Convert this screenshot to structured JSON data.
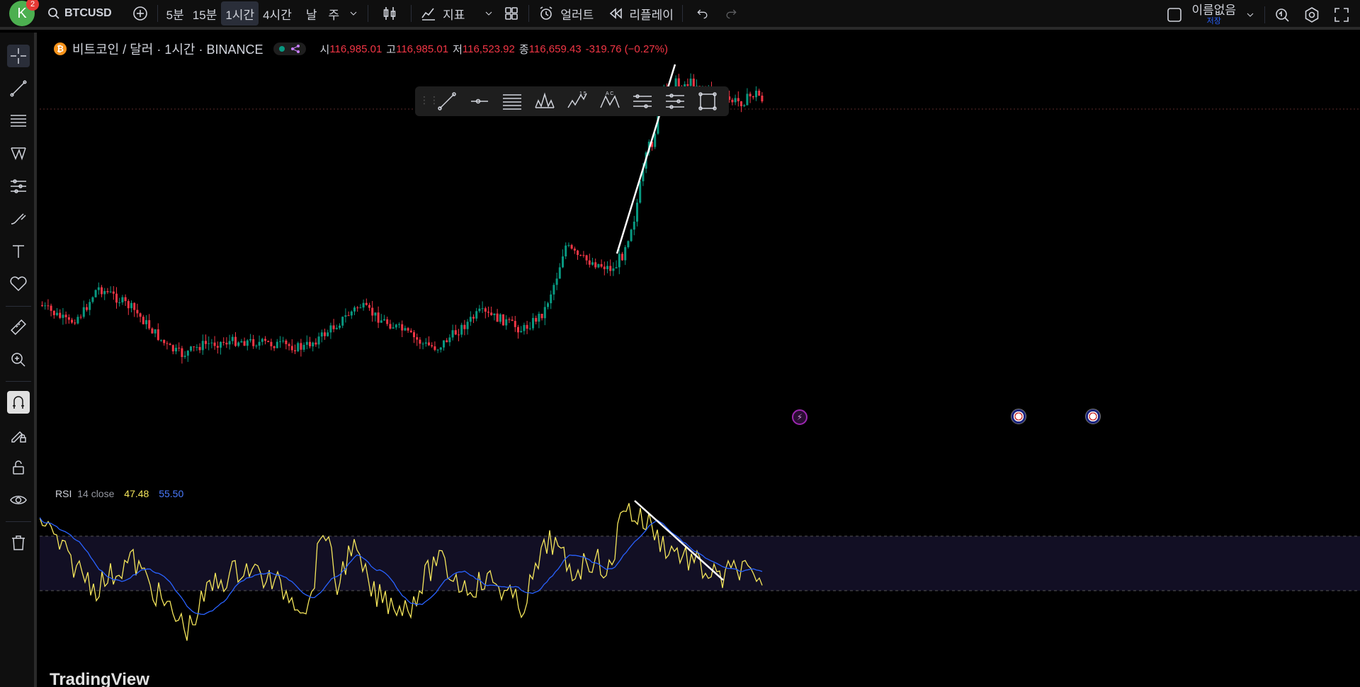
{
  "topbar": {
    "avatar_letter": "K",
    "notification_count": "2",
    "symbol": "BTCUSD",
    "intervals": [
      "5분",
      "15분",
      "1시간",
      "4시간",
      "날",
      "주"
    ],
    "active_interval": "1시간",
    "indicators_label": "지표",
    "alerts_label": "얼러트",
    "replay_label": "리플레이",
    "layout_name": "이름없음",
    "layout_save_label": "저장"
  },
  "legend": {
    "coin_glyph": "₿",
    "title": "비트코인 / 달러 · 1시간 · BINANCE",
    "open_label": "시",
    "open": "116,985.01",
    "high_label": "고",
    "high": "116,985.01",
    "low_label": "저",
    "low": "116,523.92",
    "close_label": "종",
    "close": "116,659.43",
    "change": "-319.76 (−0.27%)"
  },
  "rsi": {
    "name": "RSI",
    "params": "14 close",
    "value": "47.48",
    "ma_value": "55.50"
  },
  "watermark": "TradingView",
  "colors": {
    "up": "#089981",
    "down": "#f23645",
    "rsi_line": "#f5e65b",
    "rsi_ma": "#2962ff",
    "trendline": "#ffffff"
  },
  "icons": {
    "left_toolbar": [
      "crosshair-icon",
      "trendline-icon",
      "fib-icon",
      "pattern-icon",
      "forecast-icon",
      "brush-icon",
      "text-icon",
      "heart-icon",
      "ruler-icon",
      "zoom-in-icon",
      "magnet-icon",
      "lock-pencil-icon",
      "lock-icon",
      "eye-icon",
      "trash-icon"
    ]
  },
  "chart_data": {
    "type": "candlestick",
    "symbol": "BTCUSD",
    "interval": "1시간",
    "exchange": "BINANCE",
    "last_bar": {
      "open": 116985.01,
      "high": 116985.01,
      "low": 116523.92,
      "close": 116659.43,
      "change": -319.76,
      "change_pct": -0.27
    },
    "rsi": {
      "length": 14,
      "source": "close",
      "value": 47.48,
      "ma_value": 55.5,
      "bands": [
        70,
        30
      ]
    }
  }
}
